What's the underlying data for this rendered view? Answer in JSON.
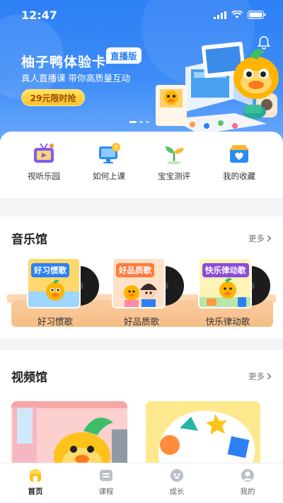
{
  "status_bar": {
    "time": "12:47"
  },
  "hero": {
    "title": "柚子鸭体验卡",
    "tag": "直播版",
    "subtitle": "真人直播课 带你高质量互动",
    "cta": "29元限时抢",
    "carousel_count": 3,
    "carousel_active": 0,
    "colors": {
      "bg_top": "#2d7ff5",
      "cta": "#ffc12a"
    }
  },
  "quick_entries": [
    {
      "label": "视听乐园",
      "icon": "tv-icon"
    },
    {
      "label": "如何上课",
      "icon": "monitor-help-icon"
    },
    {
      "label": "宝宝测评",
      "icon": "sprout-icon"
    },
    {
      "label": "我的收藏",
      "icon": "favorite-box-icon"
    }
  ],
  "music_section": {
    "title": "音乐馆",
    "more": "更多",
    "albums": [
      {
        "badge": "好习惯歌",
        "label": "好习惯歌",
        "color": "#2d7ff5"
      },
      {
        "badge": "好品质歌",
        "label": "好品质歌",
        "color": "#ff7a3c"
      },
      {
        "badge": "快乐律动歌",
        "label": "快乐律动歌",
        "color": "#8b4cd9"
      }
    ]
  },
  "video_section": {
    "title": "视频馆",
    "more": "更多"
  },
  "tabbar": [
    {
      "label": "首页",
      "icon": "home-icon",
      "active": true
    },
    {
      "label": "课程",
      "icon": "course-icon",
      "active": false
    },
    {
      "label": "成长",
      "icon": "growth-icon",
      "active": false
    },
    {
      "label": "我的",
      "icon": "profile-icon",
      "active": false
    }
  ]
}
